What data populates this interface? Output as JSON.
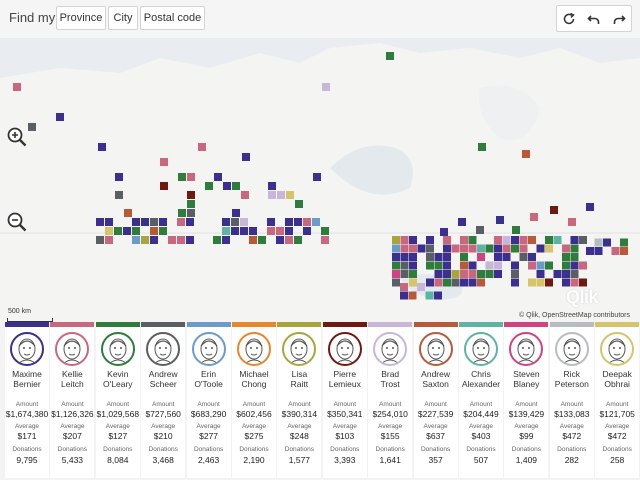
{
  "find": {
    "label": "Find my:",
    "buttons": [
      "Province",
      "City",
      "Postal code"
    ]
  },
  "toolbar": {
    "icons": [
      "refresh-icon",
      "undo-icon",
      "redo-icon"
    ]
  },
  "map": {
    "scale_label": "500 km",
    "logo": "Qlik",
    "attribution": "© Qlik, OpenStreetMap contributors"
  },
  "labels": {
    "amount": "Amount",
    "average": "Average",
    "donations": "Donations"
  },
  "candidates": [
    {
      "first": "Maxime",
      "last": "Bernier",
      "amount": "$1,674,380",
      "average": "$171",
      "donations": "9,795",
      "color": "#3b2f8f"
    },
    {
      "first": "Kellie",
      "last": "Leitch",
      "amount": "$1,126,326",
      "average": "$207",
      "donations": "5,433",
      "color": "#c9677e"
    },
    {
      "first": "Kevin",
      "last": "O'Leary",
      "amount": "$1,029,568",
      "average": "$127",
      "donations": "8,084",
      "color": "#2e7d3c"
    },
    {
      "first": "Andrew",
      "last": "Scheer",
      "amount": "$727,560",
      "average": "$210",
      "donations": "3,468",
      "color": "#5a5f66"
    },
    {
      "first": "Erin",
      "last": "O'Toole",
      "amount": "$683,290",
      "average": "$277",
      "donations": "2,463",
      "color": "#6b9bc9"
    },
    {
      "first": "Michael",
      "last": "Chong",
      "amount": "$602,456",
      "average": "$275",
      "donations": "2,190",
      "color": "#e8862a"
    },
    {
      "first": "Lisa",
      "last": "Raitt",
      "amount": "$390,314",
      "average": "$248",
      "donations": "1,577",
      "color": "#a8a63a"
    },
    {
      "first": "Pierre",
      "last": "Lemieux",
      "amount": "$350,341",
      "average": "$103",
      "donations": "3,393",
      "color": "#6e1a12"
    },
    {
      "first": "Brad",
      "last": "Trost",
      "amount": "$254,010",
      "average": "$155",
      "donations": "1,641",
      "color": "#c8b6d8"
    },
    {
      "first": "Andrew",
      "last": "Saxton",
      "amount": "$227,539",
      "average": "$637",
      "donations": "357",
      "color": "#b85a3a"
    },
    {
      "first": "Chris",
      "last": "Alexander",
      "amount": "$204,449",
      "average": "$403",
      "donations": "507",
      "color": "#5db3a4"
    },
    {
      "first": "Steven",
      "last": "Blaney",
      "amount": "$139,429",
      "average": "$99",
      "donations": "1,409",
      "color": "#d0437e"
    },
    {
      "first": "Rick",
      "last": "Peterson",
      "amount": "$133,083",
      "average": "$472",
      "donations": "282",
      "color": "#b7bcc2"
    },
    {
      "first": "Deepak",
      "last": "Obhrai",
      "amount": "$121,705",
      "average": "$472",
      "donations": "258",
      "color": "#d6c46a"
    }
  ]
}
